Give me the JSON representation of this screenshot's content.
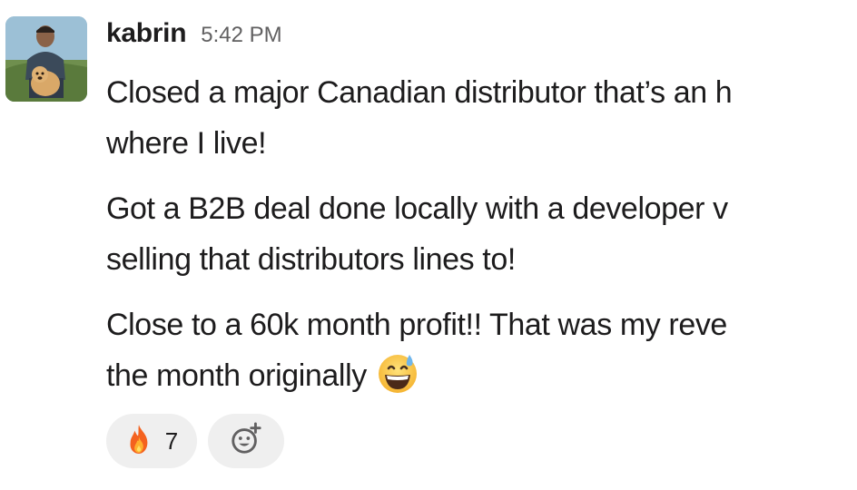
{
  "message": {
    "author": "kabrin",
    "timestamp": "5:42 PM",
    "paragraphs": {
      "p1": {
        "line1": "Closed a major Canadian distributor that’s an h",
        "line2": "where I live!"
      },
      "p2": {
        "line1": "Got a B2B deal done locally with a developer v",
        "line2": "selling that distributors lines to!"
      },
      "p3": {
        "line1": "Close to a 60k month profit!! That was my reve",
        "line2": "the month originally"
      }
    },
    "inline_emoji": "grinning-face-with-sweat-icon"
  },
  "reactions": [
    {
      "icon": "fire-icon",
      "count": "7"
    },
    {
      "icon": "add-reaction-icon"
    }
  ],
  "colors": {
    "text": "#1d1c1d",
    "timestamp": "#616061",
    "reaction_bg": "#efefef"
  }
}
